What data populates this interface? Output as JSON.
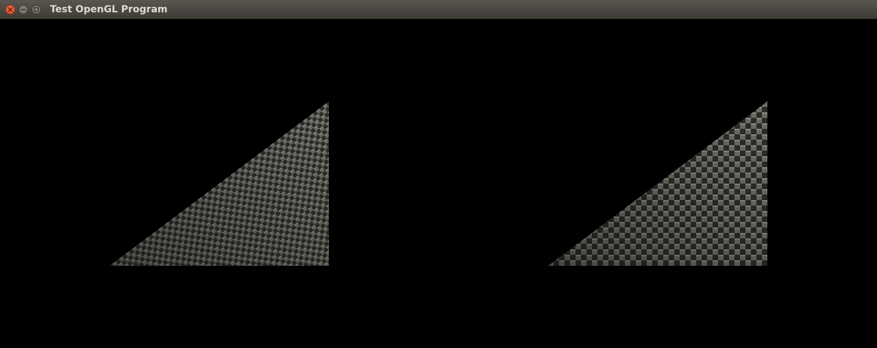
{
  "window": {
    "title": "Test OpenGL Program",
    "controls": {
      "close_icon": "close-icon",
      "minimize_icon": "minimize-icon",
      "maximize_icon": "maximize-icon"
    }
  },
  "viewport": {
    "background": "#000000",
    "objects": [
      {
        "kind": "textured-triangle",
        "texture": "carbon-fiber-weave",
        "tint": "#6a6a62"
      },
      {
        "kind": "textured-triangle",
        "texture": "checkerboard-weave",
        "tint": "#6a6a62"
      }
    ]
  }
}
